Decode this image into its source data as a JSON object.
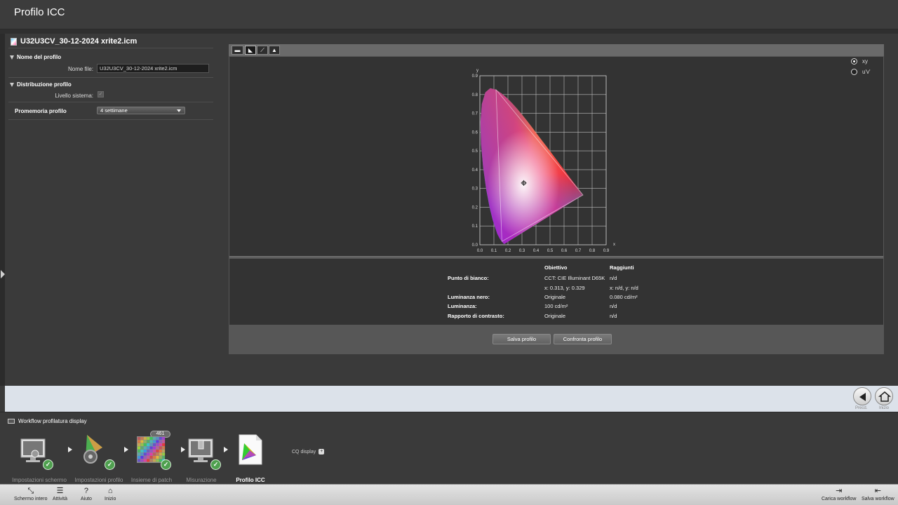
{
  "window": {
    "title": "Profilo ICC"
  },
  "left_panel": {
    "file_title": "U32U3CV_30-12-2024 xrite2.icm",
    "section_name": "Nome del profilo",
    "filename_label": "Nome file:",
    "filename_value": "U32U3CV_30-12-2024 xrite2.icm",
    "section_distribution": "Distribuzione profilo",
    "system_level_label": "Livello sistema:",
    "system_level_checked": true,
    "reminder_label": "Promemoria profilo",
    "reminder_value": "4 settimane"
  },
  "toolbar": {
    "icons": [
      "profile-gamut-icon",
      "cursor-icon",
      "curve-icon",
      "image-icon"
    ]
  },
  "chart": {
    "radio_xy": "xy",
    "radio_uv": "u'v'",
    "selected": "xy",
    "x_axis_label": "x",
    "y_axis_label": "y",
    "x_ticks": [
      "0.0",
      "0.1",
      "0.2",
      "0.3",
      "0.4",
      "0.5",
      "0.6",
      "0.7",
      "0.8",
      "0.9"
    ],
    "y_ticks": [
      "0.0",
      "0.1",
      "0.2",
      "0.3",
      "0.4",
      "0.5",
      "0.6",
      "0.7",
      "0.8",
      "0.9"
    ]
  },
  "chart_data": {
    "type": "scatter",
    "title": "",
    "xlabel": "x",
    "ylabel": "y",
    "xlim": [
      0,
      0.9
    ],
    "ylim": [
      0,
      0.9
    ],
    "grid": true,
    "gamut_triangle": {
      "red": [
        0.735,
        0.265
      ],
      "green": [
        0.115,
        0.826
      ],
      "blue": [
        0.157,
        0.018
      ]
    },
    "white_point": [
      0.313,
      0.329
    ]
  },
  "info_table": {
    "col_target": "Obiettivo",
    "col_achieved": "Raggiunti",
    "rows": [
      {
        "label": "Punto di bianco:",
        "target": "CCT: CIE Illuminant D65K",
        "achieved": "n/d"
      },
      {
        "label": "",
        "target": "x: 0.313, y: 0.329",
        "achieved": "x: n/d, y: n/d"
      },
      {
        "label": "Luminanza nero:",
        "target": "Originale",
        "achieved": "0.080 cd/m²"
      },
      {
        "label": "Luminanza:",
        "target": "100 cd/m²",
        "achieved": "n/d"
      },
      {
        "label": "Rapporto di contrasto:",
        "target": "Originale",
        "achieved": "n/d"
      }
    ]
  },
  "buttons": {
    "save": "Salva profilo",
    "compare": "Confronta profilo"
  },
  "nav": {
    "prev": "Precd.",
    "home": "Inizio"
  },
  "workflow": {
    "title": "Workflow profilatura display",
    "patch_count": "461",
    "cq_label": "CQ display",
    "steps": [
      {
        "label": "Impostazioni schermo",
        "done": true
      },
      {
        "label": "Impostazioni profilo",
        "done": true
      },
      {
        "label": "Insieme di patch",
        "done": true
      },
      {
        "label": "Misurazione",
        "done": true
      },
      {
        "label": "Profilo ICC",
        "done": false
      }
    ]
  },
  "bottom_bar": {
    "fullscreen": "Schermo intero",
    "activities": "Attività",
    "help": "Aiuto",
    "home": "Inizio",
    "load_workflow": "Carica workflow",
    "save_workflow": "Salva workflow"
  },
  "colors": {
    "accent_check": "#4fa04f",
    "background": "#3a3a3a"
  }
}
